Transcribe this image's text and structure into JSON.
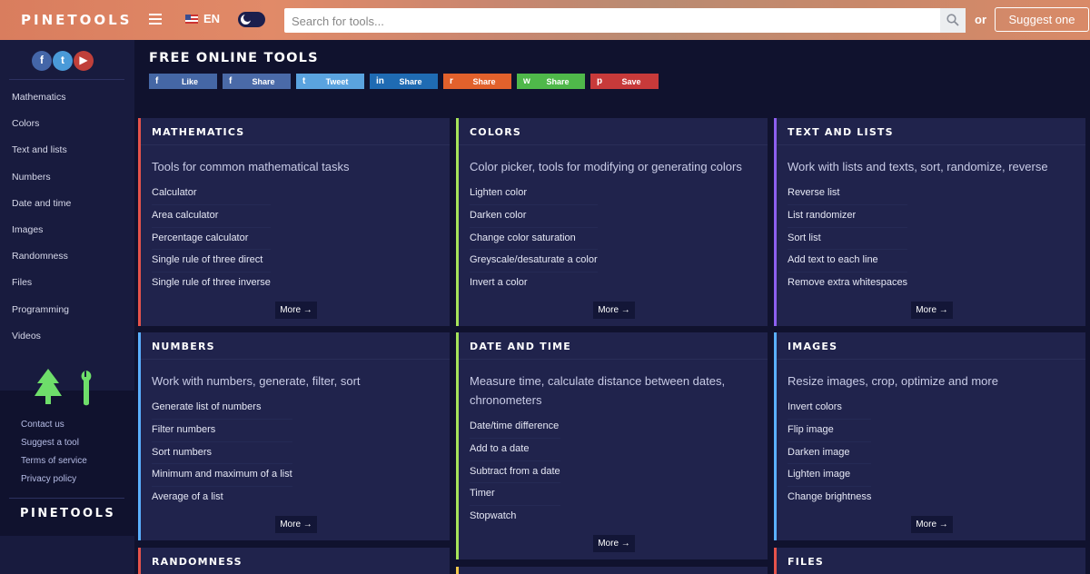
{
  "header": {
    "logo": "PINETOOLS",
    "lang": "EN",
    "search_placeholder": "Search for tools...",
    "or_text": "or",
    "suggest_label": "Suggest one"
  },
  "sidebar": {
    "socials": [
      {
        "name": "facebook",
        "glyph": "f",
        "color": "#4466a8"
      },
      {
        "name": "twitter",
        "glyph": "t",
        "color": "#4a9ad8"
      },
      {
        "name": "youtube",
        "glyph": "▶",
        "color": "#c0403a"
      }
    ],
    "nav": [
      "Mathematics",
      "Colors",
      "Text and lists",
      "Numbers",
      "Date and time",
      "Images",
      "Randomness",
      "Files",
      "Programming",
      "Videos"
    ],
    "links": [
      "Contact us",
      "Suggest a tool",
      "Terms of service",
      "Privacy policy"
    ],
    "logo": "PINETOOLS"
  },
  "main": {
    "title": "FREE ONLINE TOOLS",
    "share_buttons": [
      {
        "label": "Like",
        "icon": "f",
        "color": "#4567a5"
      },
      {
        "label": "Share",
        "icon": "f",
        "color": "#4a6aa8"
      },
      {
        "label": "Tweet",
        "icon": "t",
        "color": "#5aa3df"
      },
      {
        "label": "Share",
        "icon": "in",
        "color": "#1f6bb3"
      },
      {
        "label": "Share",
        "icon": "r",
        "color": "#e2612c"
      },
      {
        "label": "Share",
        "icon": "w",
        "color": "#4fb84a"
      },
      {
        "label": "Save",
        "icon": "p",
        "color": "#c73a3a"
      }
    ],
    "more_label": "More →",
    "cards": {
      "mathematics": {
        "title": "MATHEMATICS",
        "accent": "#e5534b",
        "desc": "Tools for common mathematical tasks",
        "items": [
          "Calculator",
          "Area calculator",
          "Percentage calculator",
          "Single rule of three direct",
          "Single rule of three inverse"
        ]
      },
      "colors": {
        "title": "COLORS",
        "accent": "#a6e35a",
        "desc": "Color picker, tools for modifying or generating colors",
        "items": [
          "Lighten color",
          "Darken color",
          "Change color saturation",
          "Greyscale/desaturate a color",
          "Invert a color"
        ]
      },
      "text_lists": {
        "title": "TEXT AND LISTS",
        "accent": "#8d5ff0",
        "desc": "Work with lists and texts, sort, randomize, reverse",
        "items": [
          "Reverse list",
          "List randomizer",
          "Sort list",
          "Add text to each line",
          "Remove extra whitespaces"
        ]
      },
      "numbers": {
        "title": "NUMBERS",
        "accent": "#5ab0ff",
        "desc": "Work with numbers, generate, filter, sort",
        "items": [
          "Generate list of numbers",
          "Filter numbers",
          "Sort numbers",
          "Minimum and maximum of a list",
          "Average of a list"
        ]
      },
      "date_time": {
        "title": "DATE AND TIME",
        "accent": "#a6e35a",
        "desc": "Measure time, calculate distance between dates, chronometers",
        "items": [
          "Date/time difference",
          "Add to a date",
          "Subtract from a date",
          "Timer",
          "Stopwatch"
        ]
      },
      "images": {
        "title": "IMAGES",
        "accent": "#5ab0ff",
        "desc": "Resize images, crop, optimize and more",
        "items": [
          "Invert colors",
          "Flip image",
          "Darken image",
          "Lighten image",
          "Change brightness"
        ]
      },
      "randomness": {
        "title": "RANDOMNESS",
        "accent": "#e5534b"
      },
      "files": {
        "title": "FILES",
        "accent": "#e5534b"
      },
      "next_col2": {
        "accent": "#f2c84b"
      }
    }
  }
}
